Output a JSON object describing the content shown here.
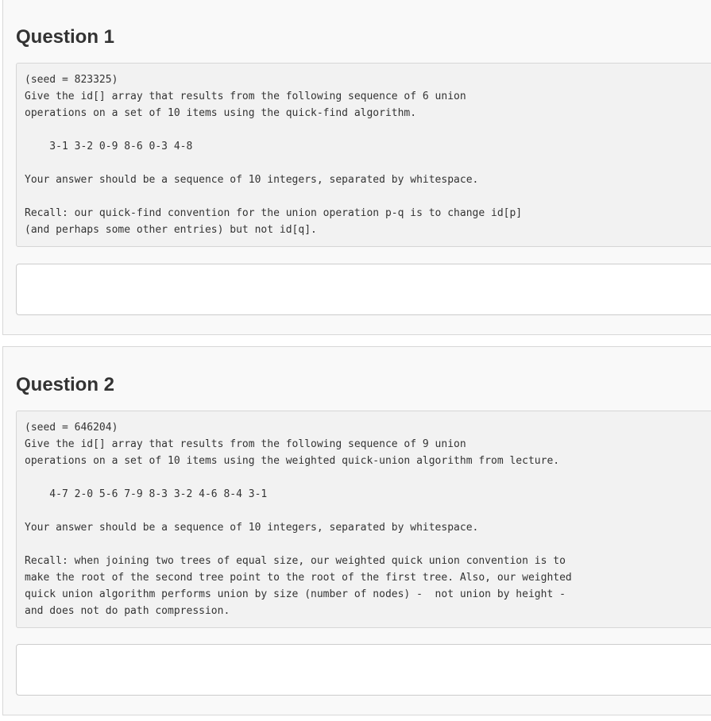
{
  "questions": [
    {
      "title": "Question 1",
      "prompt": "(seed = 823325)\nGive the id[] array that results from the following sequence of 6 union\noperations on a set of 10 items using the quick-find algorithm.\n\n    3-1 3-2 0-9 8-6 0-3 4-8\n\nYour answer should be a sequence of 10 integers, separated by whitespace.\n\nRecall: our quick-find convention for the union operation p-q is to change id[p]\n(and perhaps some other entries) but not id[q].",
      "answer_value": ""
    },
    {
      "title": "Question 2",
      "prompt": "(seed = 646204)\nGive the id[] array that results from the following sequence of 9 union\noperations on a set of 10 items using the weighted quick-union algorithm from lecture.\n\n    4-7 2-0 5-6 7-9 8-3 3-2 4-6 8-4 3-1\n\nYour answer should be a sequence of 10 integers, separated by whitespace.\n\nRecall: when joining two trees of equal size, our weighted quick union convention is to\nmake the root of the second tree point to the root of the first tree. Also, our weighted\nquick union algorithm performs union by size (number of nodes) -  not union by height -\nand does not do path compression.",
      "answer_value": ""
    }
  ]
}
